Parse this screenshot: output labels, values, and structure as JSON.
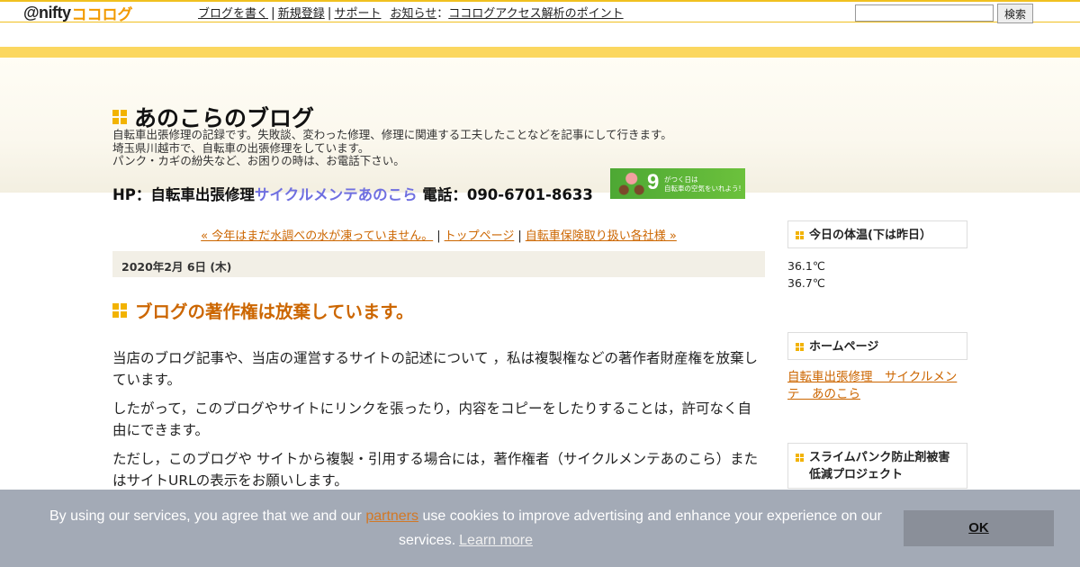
{
  "header": {
    "logo_nifty": "@nifty",
    "logo_cocolog": "ココログ",
    "nav": [
      "ブログを書く",
      "新規登録",
      "サポート"
    ],
    "news_label": "お知らせ",
    "news_colon": "：",
    "news_link": "ココログアクセス解析のポイント",
    "search_placeholder": "",
    "search_button": "検索"
  },
  "blog": {
    "title": "あのこらのブログ",
    "description": [
      "自転車出張修理の記録です。失敗談、変わった修理、修理に関連する工夫したことなどを記事にして行きます。",
      "埼玉県川越市で、自転車の出張修理をしています。",
      "パンク・カギの紛失など、お困りの時は、お電話下さい。"
    ],
    "hp_prefix": "HP：自転車出張修理",
    "hp_link": "サイクルメンテあのこら",
    "phone": " 電話：090-6701-8633",
    "promo_number": "9",
    "promo_line1": "がつく日は",
    "promo_line2": "自転車の空気をいれよう!"
  },
  "entry_nav": {
    "prev": "« 今年はまだ水調べの水が凍っていません。",
    "sep": "|",
    "top": "トップページ",
    "next": "自転車保険取り扱い各社様 »"
  },
  "entry": {
    "date": "2020年2月 6日 (木)",
    "title": "ブログの著作権は放棄しています。",
    "paragraphs": [
      "当店のブログ記事や、当店の運営するサイトの記述について ，私は複製権などの著作者財産権を放棄しています。",
      "したがって，このブログやサイトにリンクを張ったり，内容をコピーをしたりすることは，許可なく自由にできます。",
      "ただし，このブログや サイトから複製・引用する場合には，著作権者（サイクルメンテあのこら）またはサイトURLの表示をお願いします。"
    ]
  },
  "sidebar": {
    "temp_title": "今日の体温(下は昨日）",
    "temp_today": "36.1℃",
    "temp_yesterday": "36.7℃",
    "home_title": "ホームページ",
    "home_link": "自転車出張修理　サイクルメンテ　あのこら",
    "project_title": "スライムパンク防止剤被害低減プロジェクト"
  },
  "cookie": {
    "text_before": "By using our services, you agree that we and our ",
    "partners": "partners",
    "text_after": " use cookies to improve advertising and enhance your experience on our services.",
    "learn_more": "Learn more",
    "ok": "OK"
  },
  "colors": {
    "accent_orange": "#cc6600",
    "title_link_blue": "#6f6fe0",
    "banner_yellow": "#fbd760",
    "cookie_bg": "#a3aab6"
  }
}
